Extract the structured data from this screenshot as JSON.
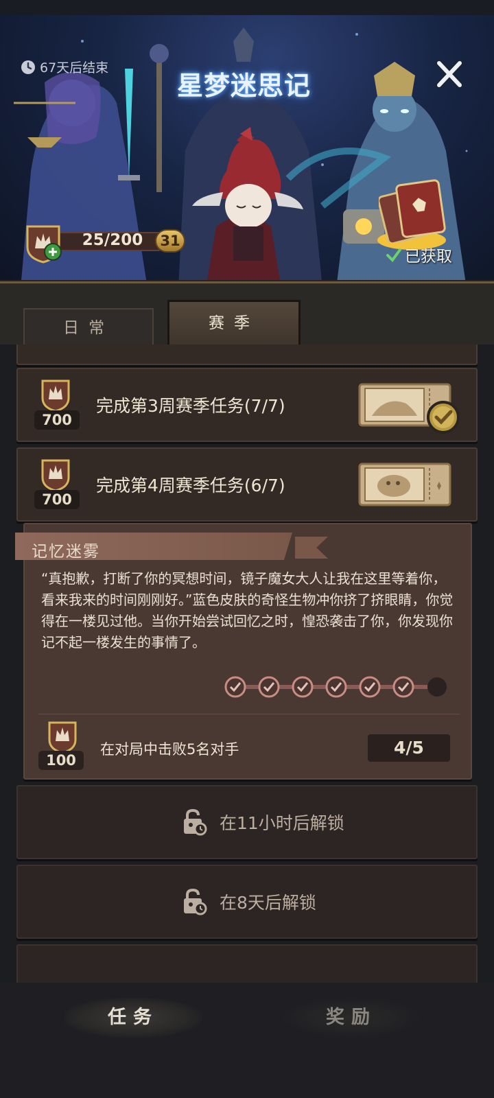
{
  "header": {
    "timer_text": "67天后结束",
    "title": "星梦迷思记",
    "progress_text": "25/200",
    "level": "31",
    "acquired_text": "已获取"
  },
  "tabs": [
    {
      "label": "日常",
      "active": false
    },
    {
      "label": "赛季",
      "active": true
    }
  ],
  "tasks": [
    {
      "points": "700",
      "title": "完成第3周赛季任务(7/7)",
      "completed": true
    },
    {
      "points": "700",
      "title": "完成第4周赛季任务(6/7)",
      "completed": false
    }
  ],
  "memory_mist": {
    "title": "记忆迷雾",
    "story": "“真抱歉，打断了你的冥想时间，镜子魔女大人让我在这里等着你，看来我来的时间刚刚好。”蓝色皮肤的奇怪生物冲你挤了挤眼睛，你觉得在一楼见过他。当你开始尝试回忆之时，惶恐袭击了你，你发现你记不起一楼发生的事情了。",
    "steps_done": 6,
    "steps_total": 7,
    "task_points": "100",
    "task_text": "在对局中击败5名对手",
    "task_progress": "4/5"
  },
  "locked": [
    {
      "text": "在11小时后解锁"
    },
    {
      "text": "在8天后解锁"
    }
  ],
  "bottom_nav": [
    {
      "label": "任务",
      "active": true
    },
    {
      "label": "奖励",
      "active": false
    }
  ],
  "colors": {
    "accent_gold": "#d8b55a",
    "card_bg": "#332a26",
    "mist_bg": "#4a3833",
    "check_green": "#6bd36b"
  }
}
